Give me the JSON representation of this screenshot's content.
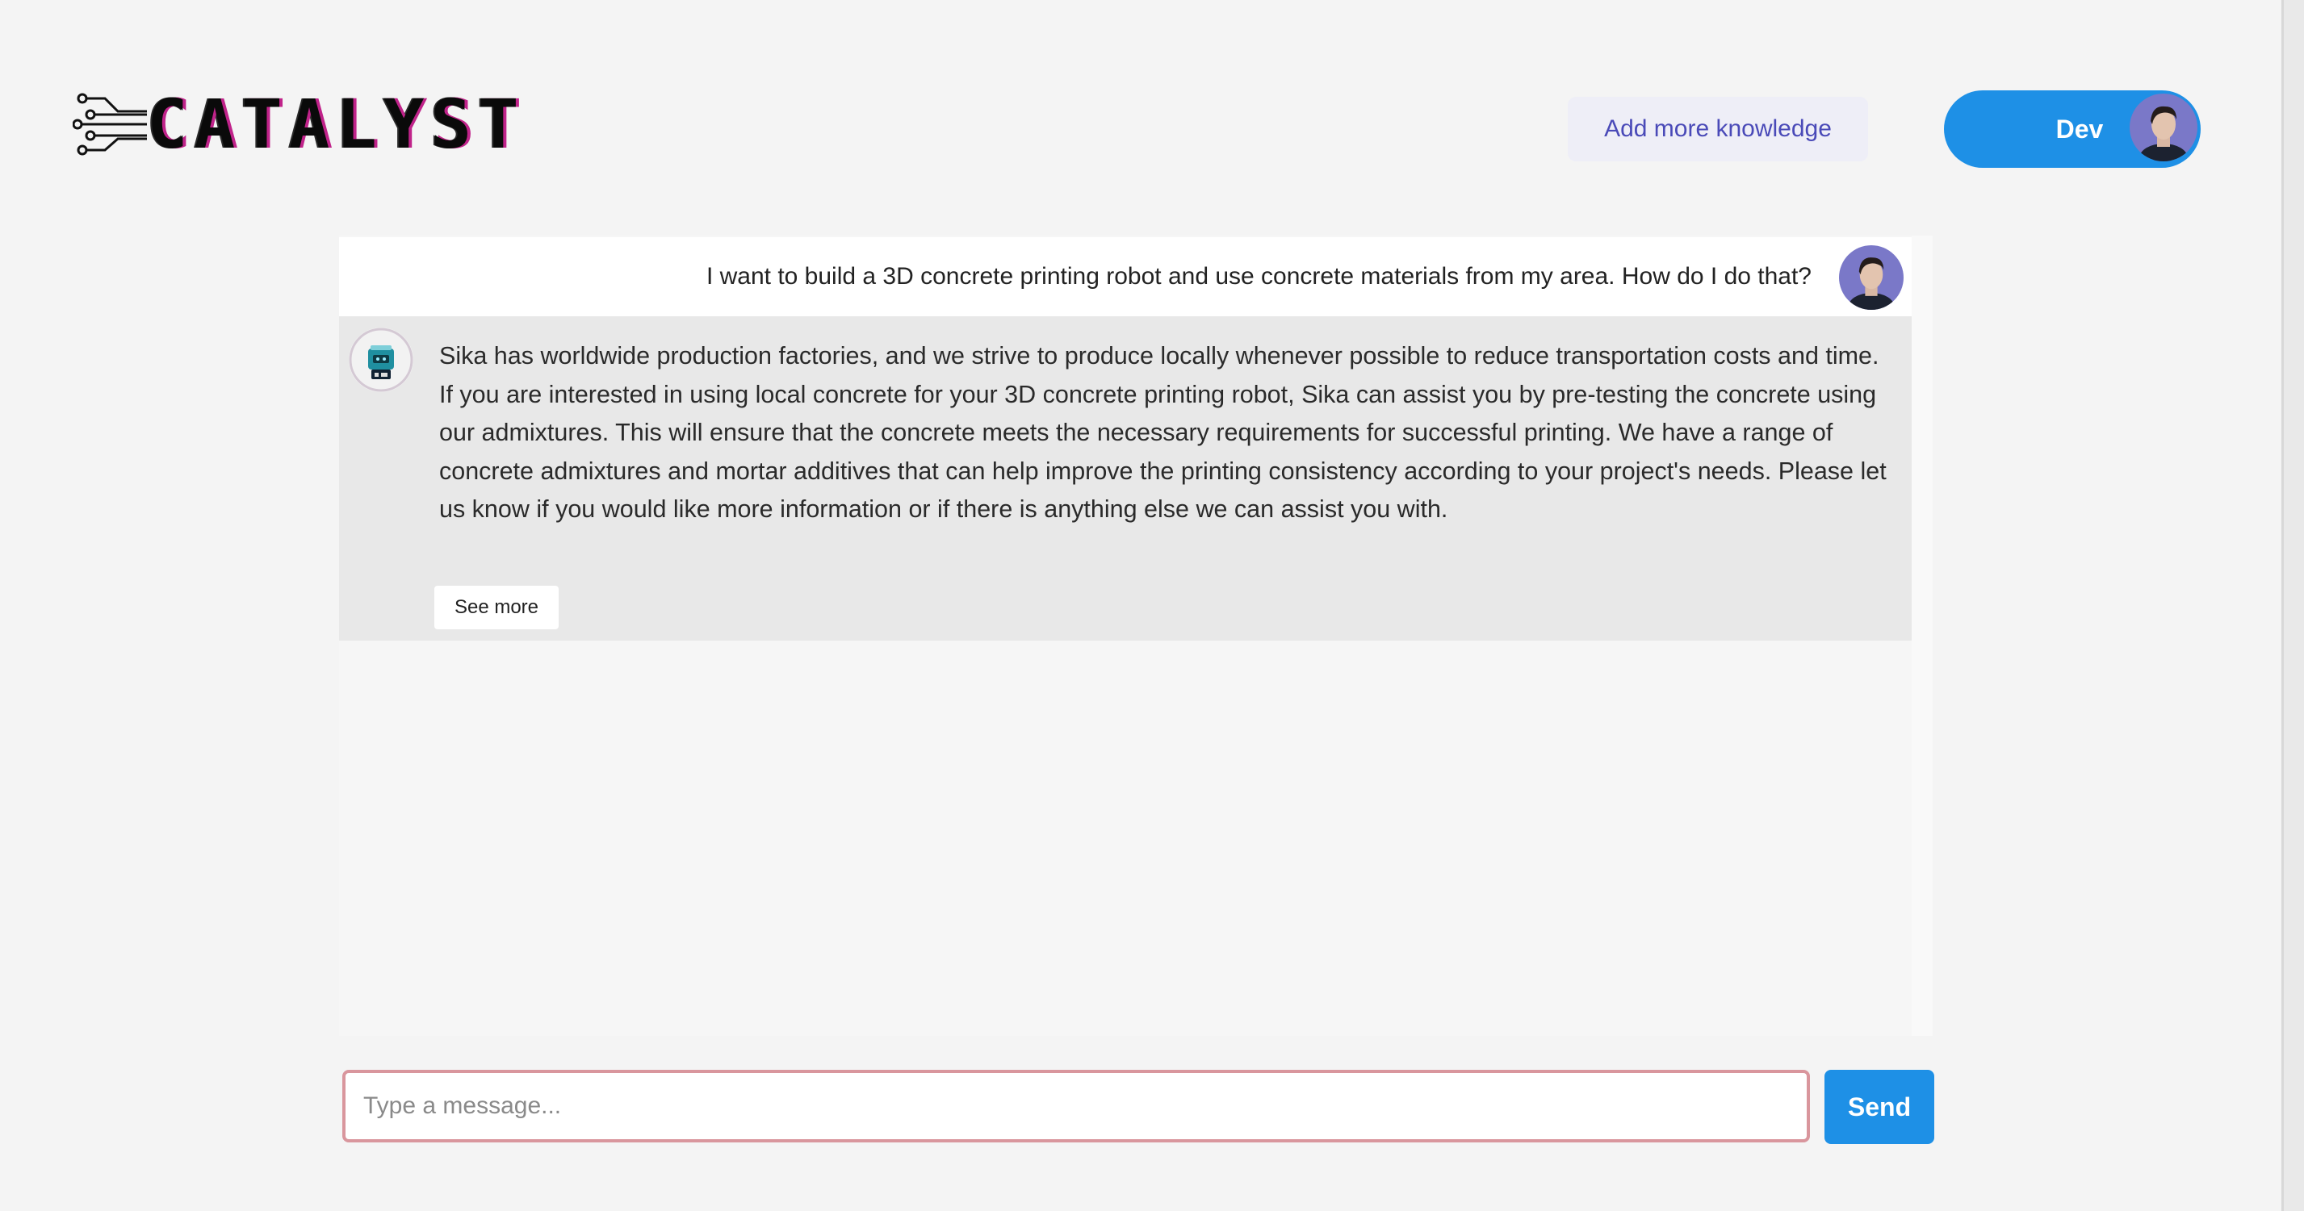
{
  "header": {
    "logo_text": "CATALYST",
    "add_knowledge_label": "Add more knowledge",
    "user_name": "Dev"
  },
  "conversation": {
    "user_message": "I want to build a 3D concrete printing robot and use concrete materials from my area. How do I do that?",
    "bot_message": "Sika has worldwide production factories, and we strive to produce locally whenever possible to reduce transportation costs and time. If you are interested in using local concrete for your 3D concrete printing robot, Sika can assist you by pre-testing the concrete using our admixtures. This will ensure that the concrete meets the necessary requirements for successful printing. We have a range of concrete admixtures and mortar additives that can help improve the printing consistency according to your project's needs. Please let us know if you would like more information or if there is anything else we can assist you with.",
    "see_more_label": "See more"
  },
  "composer": {
    "placeholder": "Type a message...",
    "value": "",
    "send_label": "Send"
  },
  "colors": {
    "accent": "#1e90e6",
    "input_border": "#d9969d",
    "bot_bubble": "#e8e8e8",
    "user_bubble": "#ffffff",
    "page_bg": "#f4f4f4",
    "logo_glitch": "#c0238a"
  },
  "icons": {
    "logo": "circuit-icon",
    "user_avatar": "user-avatar",
    "bot_avatar": "robot-avatar"
  }
}
